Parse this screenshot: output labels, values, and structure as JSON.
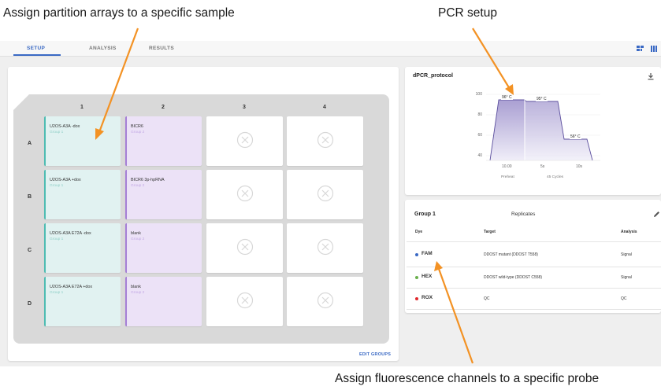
{
  "annotations": {
    "top_left": "Assign partition arrays to a specific sample",
    "top_right": "PCR setup",
    "bottom": "Assign fluorescence channels to a specific probe"
  },
  "colors": {
    "accent": "#3a69c4",
    "group1": "#4ebcb2",
    "group2": "#a57fd6",
    "arrow": "#f39224"
  },
  "tabs": [
    "SETUP",
    "ANALYSIS",
    "RESULTS"
  ],
  "plate": {
    "columns": [
      "1",
      "2",
      "3",
      "4"
    ],
    "rows": [
      "A",
      "B",
      "C",
      "D"
    ],
    "cells": [
      {
        "name": "U2OS-A3A -dox",
        "group": "Group 1"
      },
      {
        "name": "BICR6",
        "group": "Group 2"
      },
      {
        "name": "U2OS-A3A +dox",
        "group": "Group 1"
      },
      {
        "name": "BICR6 3p-hpRNA",
        "group": "Group 2"
      },
      {
        "name": "U2OS-A3A E72A -dox",
        "group": "Group 1"
      },
      {
        "name": "blank",
        "group": "Group 2"
      },
      {
        "name": "U2OS-A3A E72A +dox",
        "group": "Group 1"
      },
      {
        "name": "blank",
        "group": "Group 2"
      }
    ],
    "edit_groups": "EDIT GROUPS"
  },
  "protocol": {
    "title": "dPCR_protocol",
    "y_ticks": [
      "100",
      "80",
      "60",
      "40"
    ],
    "step_temps": [
      "96° C",
      "95° C",
      "56° C"
    ],
    "x_ticks": [
      "10.00",
      "5s",
      "10s"
    ],
    "stages": [
      "Preheat",
      "45 Cycles"
    ]
  },
  "dyes": {
    "group": "Group 1",
    "replicates": "Replicates",
    "headers": [
      "Dye",
      "Target",
      "Analysis"
    ],
    "rows": [
      {
        "dye": "FAM",
        "color": "#3a69c4",
        "target": "DDOST mutant (DDOST T558)",
        "analysis": "Signal"
      },
      {
        "dye": "HEX",
        "color": "#6ab04c",
        "target": "DDOST wild-type (DDOST C558)",
        "analysis": "Signal"
      },
      {
        "dye": "ROX",
        "color": "#e0262b",
        "target": "QC",
        "analysis": "QC"
      }
    ]
  }
}
